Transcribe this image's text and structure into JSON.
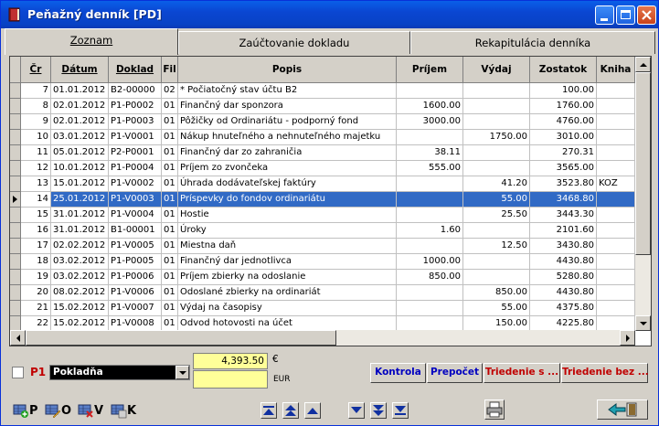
{
  "window": {
    "title": "Peňažný denník [PD]"
  },
  "tabs": [
    {
      "label": "Zoznam",
      "active": true
    },
    {
      "label": "Zaúčtovanie dokladu",
      "active": false
    },
    {
      "label": "Rekapitulácia denníka",
      "active": false
    }
  ],
  "table": {
    "headers": [
      "Čr",
      "Dátum",
      "Doklad",
      "Fil",
      "Popis",
      "Príjem",
      "Výdaj",
      "Zostatok",
      "Kniha"
    ],
    "rows": [
      [
        "7",
        "01.01.2012",
        "B2-00000",
        "02",
        "* Počiatočný stav účtu B2",
        "",
        "",
        "100.00",
        ""
      ],
      [
        "8",
        "02.01.2012",
        "P1-P0002",
        "01",
        "Finančný dar sponzora",
        "1600.00",
        "",
        "1760.00",
        ""
      ],
      [
        "9",
        "02.01.2012",
        "P1-P0003",
        "01",
        "Pôžičky od Ordinariátu - podporný fond",
        "3000.00",
        "",
        "4760.00",
        ""
      ],
      [
        "10",
        "03.01.2012",
        "P1-V0001",
        "01",
        "Nákup hnuteľného a nehnuteľného majetku",
        "",
        "1750.00",
        "3010.00",
        ""
      ],
      [
        "11",
        "05.01.2012",
        "P2-P0001",
        "01",
        "Finančný dar zo zahraničia",
        "38.11",
        "",
        "270.31",
        ""
      ],
      [
        "12",
        "10.01.2012",
        "P1-P0004",
        "01",
        "Príjem zo zvončeka",
        "555.00",
        "",
        "3565.00",
        ""
      ],
      [
        "13",
        "15.01.2012",
        "P1-V0002",
        "01",
        "Úhrada dodávateľskej faktúry",
        "",
        "41.20",
        "3523.80",
        "KOZ"
      ],
      [
        "14",
        "25.01.2012",
        "P1-V0003",
        "01",
        "Príspevky do fondov ordinariátu",
        "",
        "55.00",
        "3468.80",
        ""
      ],
      [
        "15",
        "31.01.2012",
        "P1-V0004",
        "01",
        "Hostie",
        "",
        "25.50",
        "3443.30",
        ""
      ],
      [
        "16",
        "31.01.2012",
        "B1-00001",
        "01",
        "Úroky",
        "1.60",
        "",
        "2101.60",
        ""
      ],
      [
        "17",
        "02.02.2012",
        "P1-V0005",
        "01",
        "Miestna daň",
        "",
        "12.50",
        "3430.80",
        ""
      ],
      [
        "18",
        "03.02.2012",
        "P1-P0005",
        "01",
        "Finančný dar jednotlivca",
        "1000.00",
        "",
        "4430.80",
        ""
      ],
      [
        "19",
        "03.02.2012",
        "P1-P0006",
        "01",
        "Príjem zbierky na odoslanie",
        "850.00",
        "",
        "5280.80",
        ""
      ],
      [
        "20",
        "08.02.2012",
        "P1-V0006",
        "01",
        "Odoslané zbierky na ordinariát",
        "",
        "850.00",
        "4430.80",
        ""
      ],
      [
        "21",
        "15.02.2012",
        "P1-V0007",
        "01",
        "Výdaj na časopisy",
        "",
        "55.00",
        "4375.80",
        ""
      ],
      [
        "22",
        "15.02.2012",
        "P1-V0008",
        "01",
        "Odvod hotovosti na účet",
        "",
        "150.00",
        "4225.80",
        ""
      ]
    ],
    "selected_row": 7
  },
  "footer": {
    "account_code": "P1",
    "account_name": "Pokladňa",
    "balance": "4,393.50",
    "currency_symbol": "€",
    "currency_code": "EUR",
    "buttons": [
      {
        "label": "Kontrola",
        "color": "#0000C0"
      },
      {
        "label": "Prepočet",
        "color": "#0000C0"
      },
      {
        "label": "Triedenie s ...",
        "color": "#C00000"
      },
      {
        "label": "Triedenie bez ...",
        "color": "#C00000"
      }
    ]
  },
  "toolbar": {
    "items": [
      {
        "icon": "add-record-icon",
        "letter": "P"
      },
      {
        "icon": "edit-record-icon",
        "letter": "O"
      },
      {
        "icon": "delete-record-icon",
        "letter": "V"
      },
      {
        "icon": "calculator-icon",
        "letter": "K"
      }
    ],
    "nav": [
      "first-icon",
      "page-up-icon",
      "up-icon",
      "down-icon",
      "page-down-icon",
      "last-icon"
    ],
    "print_icon": "printer-icon",
    "exit_icon": "exit-icon"
  }
}
